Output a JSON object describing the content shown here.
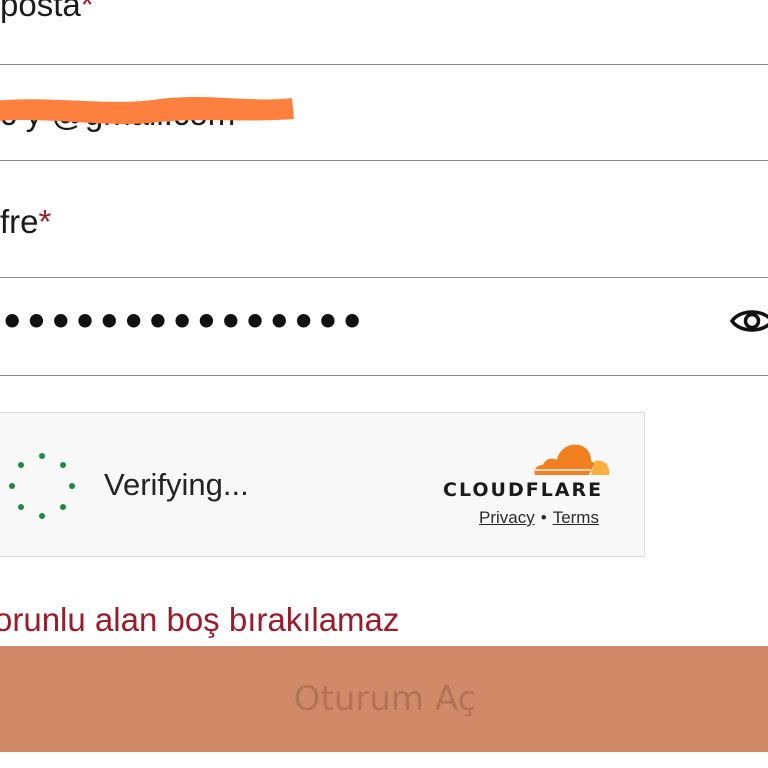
{
  "form": {
    "email_label": "posta",
    "email_required_mark": "*",
    "email_value": "c      y    @gmail.com",
    "password_label": "fre",
    "password_required_mark": "*",
    "password_value": "•••••••••••••••",
    "show_password_icon": "eye-icon"
  },
  "captcha": {
    "status_text": "Verifying...",
    "brand": "CLOUDFLARE",
    "privacy_link": "Privacy",
    "separator": "•",
    "terms_link": "Terms",
    "spinner_icon": "loading-spinner-icon",
    "logo_icon": "cloudflare-cloud-icon"
  },
  "error_message": "orunlu alan boş bırakılamaz",
  "submit_label": "Oturum Aç",
  "colors": {
    "required_mark": "#9b1b2b",
    "error_text": "#9b1b2b",
    "button_bg": "#cf8a68",
    "button_text": "#b27356",
    "redaction": "#ff7f3f",
    "spinner_dots": "#1e8a3c",
    "cloudflare_orange": "#f38020",
    "cloudflare_light_orange": "#faae40"
  }
}
